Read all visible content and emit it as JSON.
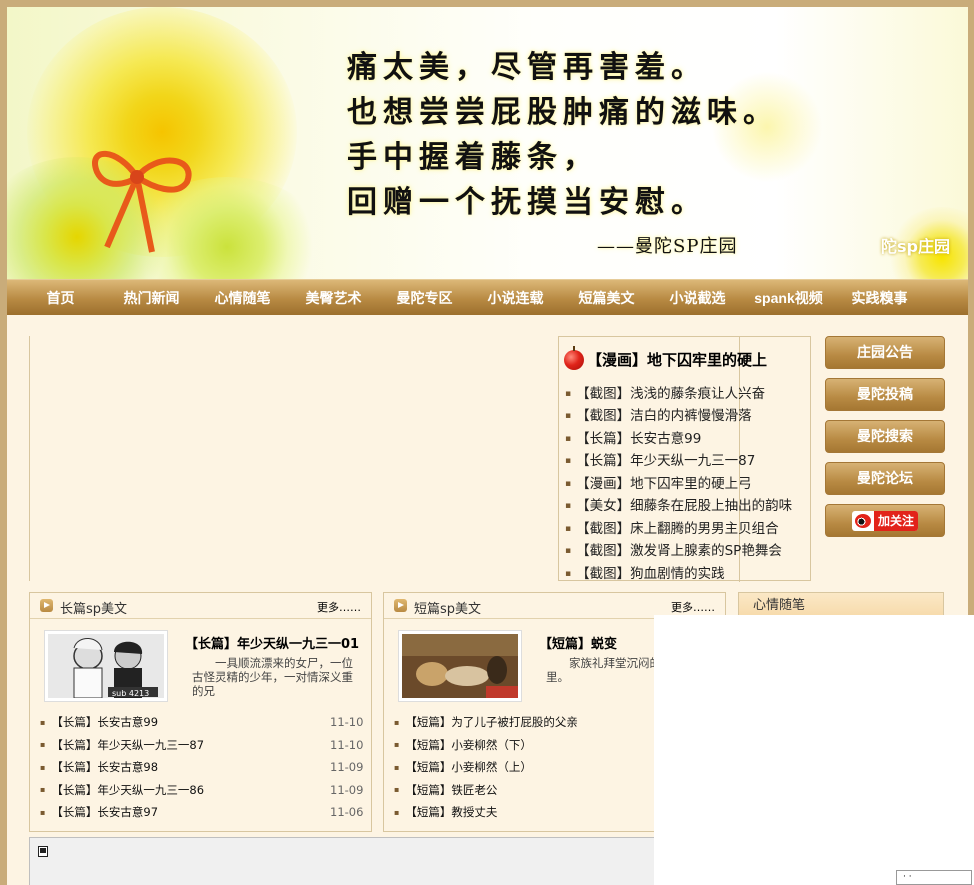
{
  "banner": {
    "poem": [
      "痛太美，尽管再害羞。",
      "也想尝尝屁股肿痛的滋味。",
      "手中握着藤条，",
      "回赠一个抚摸当安慰。"
    ],
    "signature": "——曼陀SP庄园",
    "brand": "陀sp庄园"
  },
  "nav": [
    "首页",
    "热门新闻",
    "心情随笔",
    "美臀艺术",
    "曼陀专区",
    "小说连载",
    "短篇美文",
    "小说截选",
    "spank视频",
    "实践糗事"
  ],
  "news": {
    "headline": "【漫画】地下囚牢里的硬上",
    "items": [
      "【截图】浅浅的藤条痕让人兴奋",
      "【截图】洁白的内裤慢慢滑落",
      "【长篇】长安古意99",
      "【长篇】年少天纵一九三一87",
      "【漫画】地下囚牢里的硬上弓",
      "【美女】细藤条在屁股上抽出的韵味",
      "【截图】床上翻腾的男男主贝组合",
      "【截图】激发肾上腺素的SP艳舞会",
      "【截图】狗血剧情的实践"
    ]
  },
  "side_buttons": [
    "庄园公告",
    "曼陀投稿",
    "曼陀搜索",
    "曼陀论坛"
  ],
  "weibo_label": "加关注",
  "long_panel": {
    "title": "长篇sp美文",
    "more": "更多……",
    "feature_title": "【长篇】年少天纵一九三一01",
    "feature_desc": "一具顺流漂来的女尸，一位古怪灵精的少年，一对情深义重的兄",
    "thumb_caption": "sub 4213",
    "items": [
      {
        "title": "【长篇】长安古意99",
        "date": "11-10"
      },
      {
        "title": "【长篇】年少天纵一九三一87",
        "date": "11-10"
      },
      {
        "title": "【长篇】长安古意98",
        "date": "11-09"
      },
      {
        "title": "【长篇】年少天纵一九三一86",
        "date": "11-09"
      },
      {
        "title": "【长篇】长安古意97",
        "date": "11-06"
      }
    ]
  },
  "short_panel": {
    "title": "短篇sp美文",
    "more": "更多……",
    "feature_title": "【短篇】蜕变",
    "feature_desc": "家族礼拜堂沉闷的，解室里。",
    "items": [
      {
        "title": "【短篇】为了儿子被打屁股的父亲"
      },
      {
        "title": "【短篇】小妾柳然（下）"
      },
      {
        "title": "【短篇】小妾柳然（上）"
      },
      {
        "title": "【短篇】铁匠老公"
      },
      {
        "title": "【短篇】教授丈夫"
      }
    ]
  },
  "mood_panel": {
    "title": "心情随笔"
  },
  "overlay_button": "· ·",
  "colors": {
    "nav": "#b88a43",
    "page_bg": "#fdf4e3",
    "frame": "#c9ac7a",
    "weibo": "#e2231a"
  }
}
